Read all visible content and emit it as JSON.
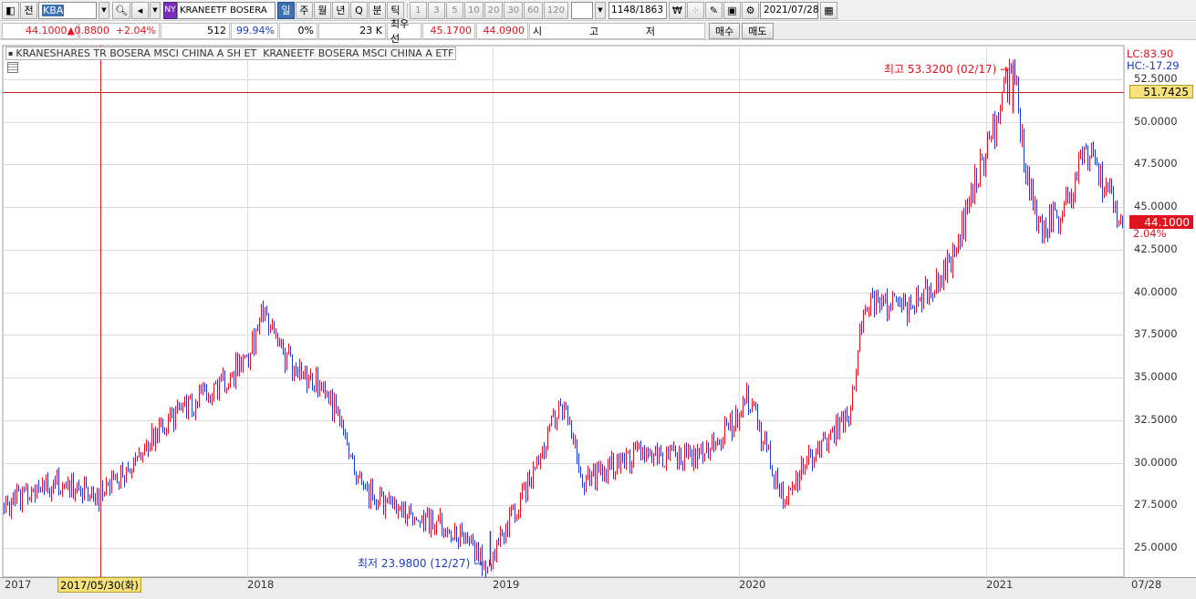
{
  "toolbar": {
    "prefix_label": "전",
    "code_value": "KBA",
    "exchange_label": "NY",
    "name_value": "KRANEETF  BOSERA",
    "period_tabs": [
      "일",
      "주",
      "월",
      "년",
      "Q",
      "분",
      "틱"
    ],
    "active_period": "일",
    "interval_values": [
      "1",
      "3",
      "5",
      "10",
      "20",
      "30",
      "60",
      "120"
    ],
    "range_value": "1148/1863",
    "date_value": "2021/07/28"
  },
  "quote": {
    "price": "44.1000",
    "change": "0.8800",
    "change_pct": "+2.04%",
    "volume": "512",
    "vol_pct": "99.94%",
    "zero_pct": "0%",
    "amount": "23 K",
    "label_best": "최우선",
    "best_ask": "45.1700",
    "best_bid": "44.0900",
    "market_labels": [
      "시",
      "고",
      "저"
    ],
    "buy_label": "매수",
    "sell_label": "매도"
  },
  "chart": {
    "title_code": "KRANESHARES TR BOSERA MSCI CHINA A SH ET",
    "title_name": "KRANEETF BOSERA MSCI CHINA A ETF",
    "lc_label": "LC:83.90",
    "hc_label": "HC:-17.29",
    "y_ticks": [
      "52.5000",
      "50.0000",
      "47.5000",
      "45.0000",
      "42.5000",
      "40.0000",
      "37.5000",
      "35.0000",
      "32.5000",
      "30.0000",
      "27.5000",
      "25.0000"
    ],
    "x_labels": [
      "2017",
      "2018",
      "2019",
      "2020",
      "2021",
      "07/28"
    ],
    "crosshair_price": "51.7425",
    "crosshair_date": "2017/05/30(화)",
    "current_price": "44.1000",
    "current_change_pct": "2.04%",
    "high_annotation": "최고 53.3200 (02/17)",
    "low_annotation": "최저 23.9800 (12/27)",
    "colors": {
      "up": "#e0141e",
      "down": "#1a3cc8",
      "crosshair": "#c81e1e",
      "grid": "#dcdcdc"
    }
  },
  "chart_data": {
    "type": "line",
    "title": "KRANEETF BOSERA MSCI CHINA A ETF",
    "xlabel": "",
    "ylabel": "",
    "ylim": [
      23.5,
      54
    ],
    "x": [
      "2017-01",
      "2017-03",
      "2017-05",
      "2017-07",
      "2017-09",
      "2017-11",
      "2018-01",
      "2018-02",
      "2018-03",
      "2018-05",
      "2018-07",
      "2018-09",
      "2018-11",
      "2018-12",
      "2019-02",
      "2019-04",
      "2019-06",
      "2019-08",
      "2019-10",
      "2019-12",
      "2020-01",
      "2020-03",
      "2020-04",
      "2020-06",
      "2020-07",
      "2020-09",
      "2020-11",
      "2021-01",
      "2021-02",
      "2021-03",
      "2021-04",
      "2021-05",
      "2021-06",
      "2021-07"
    ],
    "series": [
      {
        "values": [
          27.5,
          28.8,
          28.0,
          30.5,
          32.8,
          34.3,
          36.5,
          38.9,
          36.2,
          34.0,
          28.5,
          27.0,
          26.3,
          24.0,
          29.5,
          33.5,
          29.0,
          30.5,
          30.2,
          32.5,
          33.8,
          27.5,
          29.8,
          33.0,
          39.5,
          39.0,
          41.5,
          49.0,
          53.3,
          47.0,
          43.5,
          45.2,
          48.5,
          44.1
        ]
      }
    ],
    "high": {
      "value": 53.32,
      "date": "02/17"
    },
    "low": {
      "value": 23.98,
      "date": "12/27"
    }
  }
}
